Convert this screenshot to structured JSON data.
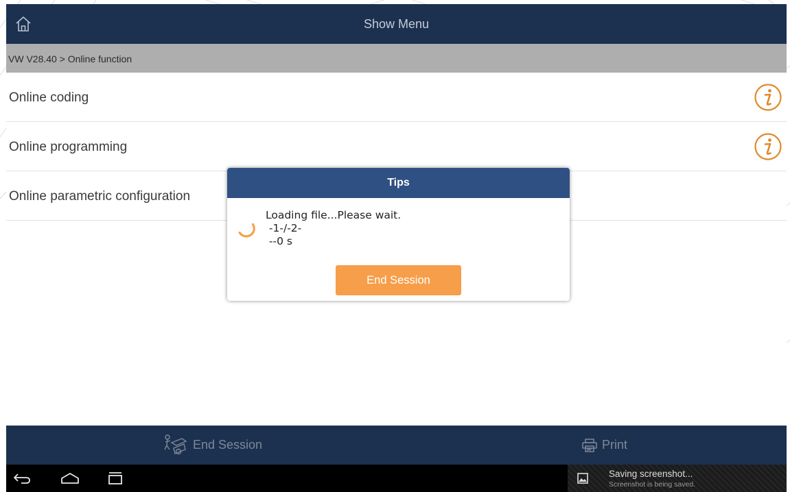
{
  "header": {
    "title": "Show Menu",
    "home_icon": "home-icon"
  },
  "breadcrumb": {
    "text": "VW V28.40 > Online function"
  },
  "menu": {
    "items": [
      {
        "label": "Online coding",
        "has_info": true
      },
      {
        "label": "Online programming",
        "has_info": true
      },
      {
        "label": "Online parametric configuration",
        "has_info": false
      }
    ],
    "info_icon_color": "#e08a2a"
  },
  "dialog": {
    "title": "Tips",
    "lines": [
      "Loading file...Please wait.",
      " -1-/-2-",
      " --0 s"
    ],
    "button_label": "End Session",
    "header_color": "#2f5083",
    "button_color": "#f79e4a"
  },
  "footer": {
    "end_session_label": "End Session",
    "print_label": "Print"
  },
  "system_nav": {
    "back_icon": "back-icon",
    "home_icon": "nav-home-icon",
    "recents_icon": "recents-icon"
  },
  "notification": {
    "title": "Saving screenshot...",
    "subtitle": "Screenshot is being saved."
  },
  "colors": {
    "header_bg": "#1c3150",
    "breadcrumb_bg": "#aeaeae",
    "accent": "#f79e4a"
  }
}
